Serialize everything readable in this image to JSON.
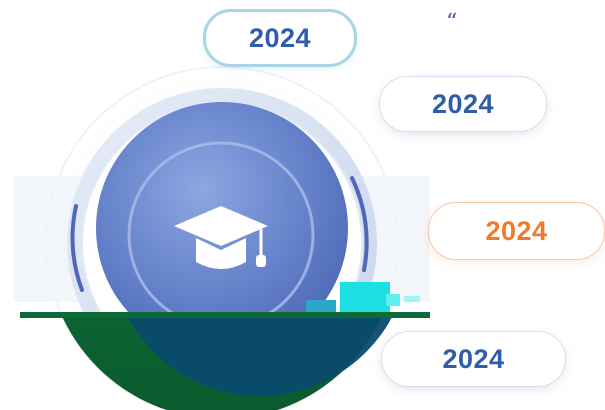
{
  "badges": [
    {
      "label": "2024",
      "accent": "#2f5da9"
    },
    {
      "label": "2024",
      "accent": "#2f5da9"
    },
    {
      "label": "2024",
      "accent": "#f07a2a"
    },
    {
      "label": "2024",
      "accent": "#2f5da9"
    }
  ],
  "quote_mark": "“",
  "center_icon": "graduation-cap-icon",
  "colors": {
    "primary_blue": "#5b7bc6",
    "dark_green": "#0f6b3a",
    "navy_overlay": "#0c4a6e",
    "cyan_glitch": "#1ee0e3",
    "orange_accent": "#f07a2a"
  }
}
